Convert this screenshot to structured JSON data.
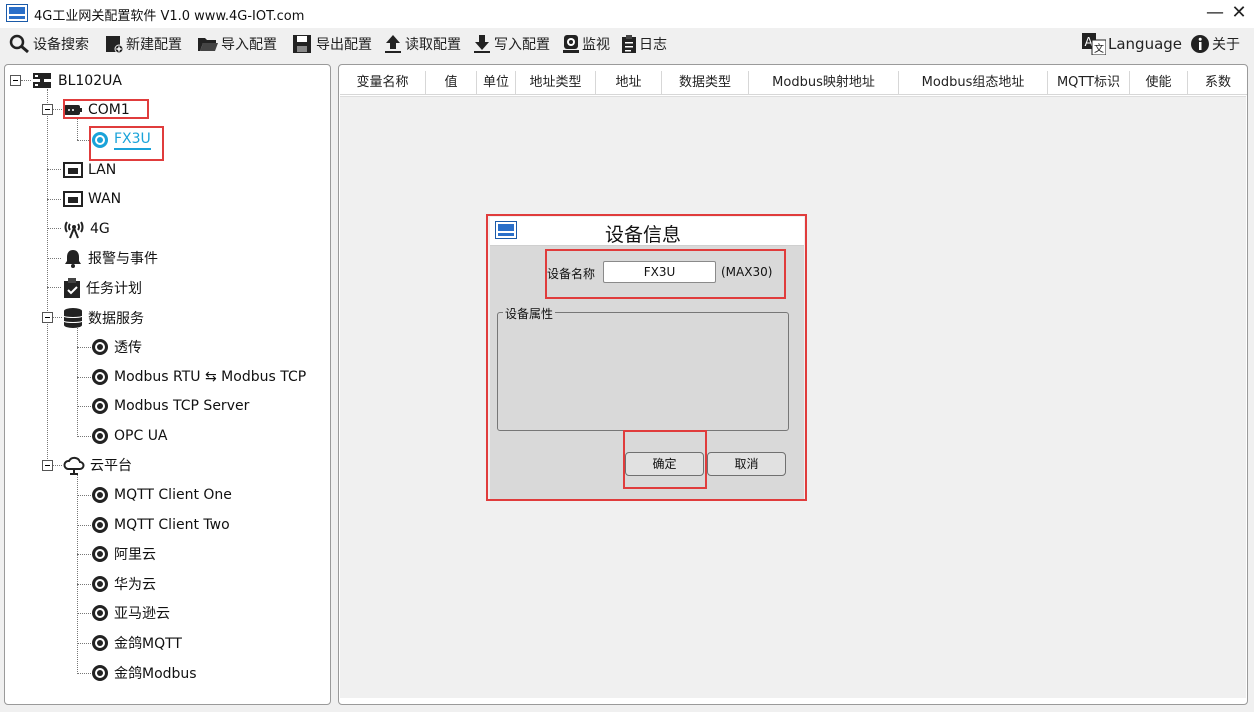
{
  "window": {
    "title": "4G工业网关配置软件 V1.0 www.4G-IOT.com",
    "minimize": "—",
    "close": "✕"
  },
  "toolbar": {
    "device_search": "设备搜索",
    "new_config": "新建配置",
    "import_config": "导入配置",
    "export_config": "导出配置",
    "read_config": "读取配置",
    "write_config": "写入配置",
    "monitor": "监视",
    "log": "日志",
    "language": "Language",
    "about": "关于"
  },
  "tree": {
    "root": "BL102UA",
    "com1": "COM1",
    "fx3u": "FX3U",
    "lan": "LAN",
    "wan": "WAN",
    "g4": "4G",
    "alarm": "报警与事件",
    "task": "任务计划",
    "data_service": "数据服务",
    "transparent": "透传",
    "rtu_tcp": "Modbus RTU ⇆ Modbus TCP",
    "tcp_server": "Modbus TCP Server",
    "opc_ua": "OPC UA",
    "cloud": "云平台",
    "mqtt_one": "MQTT Client One",
    "mqtt_two": "MQTT Client Two",
    "aliyun": "阿里云",
    "huawei": "华为云",
    "amazon": "亚马逊云",
    "jg_mqtt": "金鸽MQTT",
    "jg_modbus": "金鸽Modbus"
  },
  "table": {
    "columns": [
      "变量名称",
      "值",
      "单位",
      "地址类型",
      "地址",
      "数据类型",
      "Modbus映射地址",
      "Modbus组态地址",
      "MQTT标识",
      "使能",
      "系数"
    ]
  },
  "dialog": {
    "title": "设备信息",
    "name_label": "设备名称",
    "name_value": "FX3U",
    "max_hint": "(MAX30)",
    "group_label": "设备属性",
    "ok": "确定",
    "cancel": "取消"
  },
  "colors": {
    "highlight": "#e03c3c",
    "selected_text": "#1aa3d9",
    "icon_dark": "#222222"
  }
}
